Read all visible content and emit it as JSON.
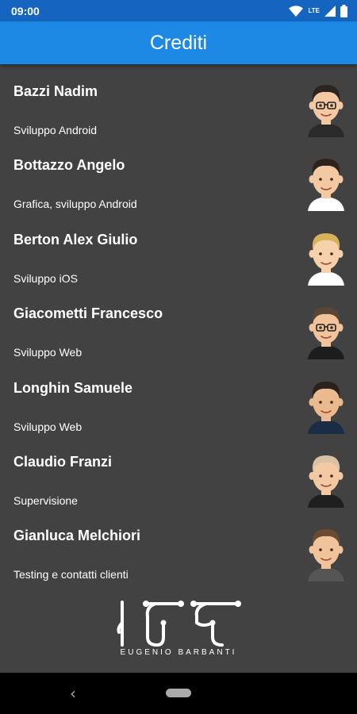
{
  "status_bar": {
    "time": "09:00",
    "network": "LTE",
    "icons": [
      "wifi-icon",
      "signal-icon",
      "battery-icon"
    ]
  },
  "app_bar": {
    "title": "Crediti"
  },
  "credits": [
    {
      "name": "Bazzi Nadim",
      "role": "Sviluppo Android",
      "avatar": "avatar-bazzi",
      "hair": "#2b2420",
      "skin": "#f3c9a4",
      "shirt": "#2a2a2a",
      "glasses": true
    },
    {
      "name": "Bottazzo Angelo",
      "role": "Grafica, sviluppo Android",
      "avatar": "avatar-bottazzo",
      "hair": "#2e221c",
      "skin": "#f3c9a4",
      "shirt": "#ffffff",
      "glasses": false
    },
    {
      "name": "Berton Alex Giulio",
      "role": "Sviluppo iOS",
      "avatar": "avatar-berton",
      "hair": "#d8b25a",
      "skin": "#f6d1aa",
      "shirt": "#ffffff",
      "glasses": false
    },
    {
      "name": "Giacometti Francesco",
      "role": "Sviluppo Web",
      "avatar": "avatar-giacometti",
      "hair": "#5a4636",
      "skin": "#f1c39b",
      "shirt": "#1d1d1d",
      "glasses": true
    },
    {
      "name": "Longhin Samuele",
      "role": "Sviluppo Web",
      "avatar": "avatar-longhin",
      "hair": "#2a211c",
      "skin": "#eab98e",
      "shirt": "#1a2c46",
      "glasses": false
    },
    {
      "name": "Claudio Franzi",
      "role": "Supervisione",
      "avatar": "avatar-franzi",
      "hair": "#d9c2a4",
      "skin": "#f3c9a4",
      "shirt": "#1f1f1f",
      "glasses": false
    },
    {
      "name": "Gianluca Melchiori",
      "role": "Testing e contatti clienti",
      "avatar": "avatar-melchiori",
      "hair": "#6b4a34",
      "skin": "#f1c39b",
      "shirt": "#555555",
      "glasses": false
    }
  ],
  "logo": {
    "text": "EUGENIO BARBANTI"
  },
  "nav_bar": {
    "back_icon": "back-chevron-icon",
    "home_icon": "home-pill-icon"
  }
}
